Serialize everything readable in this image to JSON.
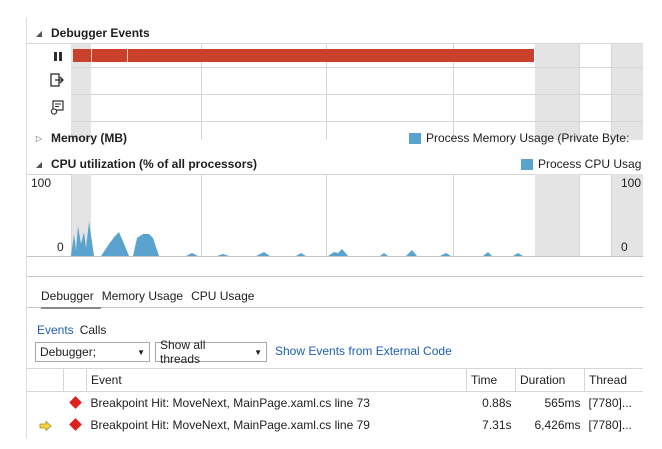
{
  "debugger_events": {
    "title": "Debugger Events",
    "rows": [
      "pause-icon",
      "step-icon",
      "output-icon"
    ]
  },
  "memory": {
    "title": "Memory (MB)",
    "legend": "Process Memory Usage (Private Byte:"
  },
  "cpu": {
    "title": "CPU utilization (% of all processors)",
    "legend": "Process CPU Usag",
    "y_max_left": "100",
    "y_min_left": "0",
    "y_max_right": "100",
    "y_min_right": "0",
    "bar_color": "#c9412b",
    "series_color": "#5ba3cf"
  },
  "tabs": {
    "debugger": "Debugger",
    "memory": "Memory Usage",
    "cpu": "CPU Usage"
  },
  "subtabs": {
    "events": "Events",
    "calls": "Calls"
  },
  "toolbar": {
    "filter_value": "Debugger;",
    "threads_value": "Show all threads",
    "external_link": "Show Events from External Code"
  },
  "table": {
    "headers": {
      "event": "Event",
      "time": "Time",
      "duration": "Duration",
      "thread": "Thread"
    },
    "rows": [
      {
        "event": "Breakpoint Hit: MoveNext, MainPage.xaml.cs line 73",
        "time": "0.88s",
        "duration": "565ms",
        "thread": "[7780]...",
        "current": false
      },
      {
        "event": "Breakpoint Hit: MoveNext, MainPage.xaml.cs line 79",
        "time": "7.31s",
        "duration": "6,426ms",
        "thread": "[7780]...",
        "current": true
      }
    ]
  }
}
